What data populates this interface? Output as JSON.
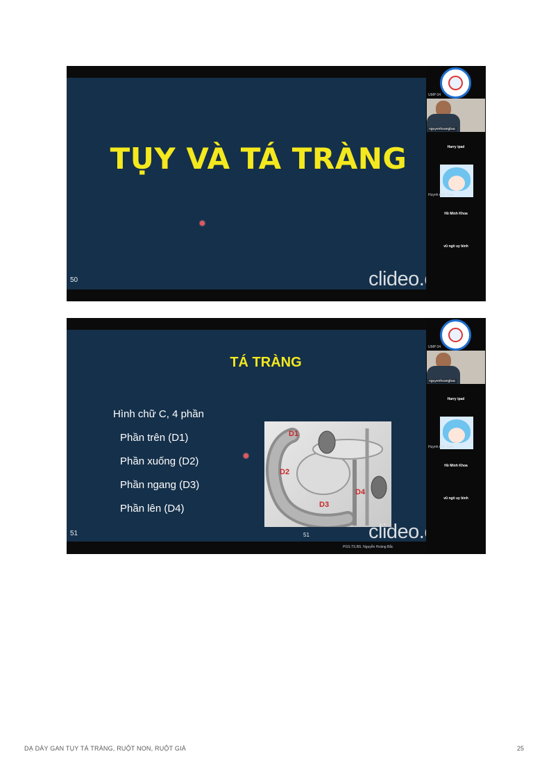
{
  "slide1": {
    "title": "TỤY VÀ TÁ TRÀNG",
    "slide_number": "50",
    "watermark": "clideo.com"
  },
  "slide2": {
    "title": "TÁ TRÀNG",
    "intro": "Hình chữ C, 4 phần",
    "parts": [
      "Phần trên (D1)",
      "Phần xuống (D2)",
      "Phần ngang (D3)",
      "Phần lên (D4)"
    ],
    "image_labels": [
      "D1",
      "D2",
      "D3",
      "D4"
    ],
    "slide_number_left": "51",
    "slide_number_center": "51",
    "credit": "PGS.TS.BS. Nguyễn Hoàng Bắc",
    "watermark": "clideo.com"
  },
  "participants": {
    "ump": "UMP 04",
    "host_name": "nguyenhoangbac",
    "names": [
      "Harry ipad",
      "Hồ Minh Khoa",
      "vũ ngô uy bình"
    ],
    "avatar_label": "Huynh Anh Tuan"
  },
  "footer": {
    "title": "DẠ DÀY GAN TỤY TÁ TRÀNG, RUỘT NON, RUỘT GIÀ",
    "page": "25"
  },
  "colors": {
    "slide_bg": "#15304a",
    "title_yellow": "#f4e81e",
    "pointer_red": "#e2585e"
  }
}
